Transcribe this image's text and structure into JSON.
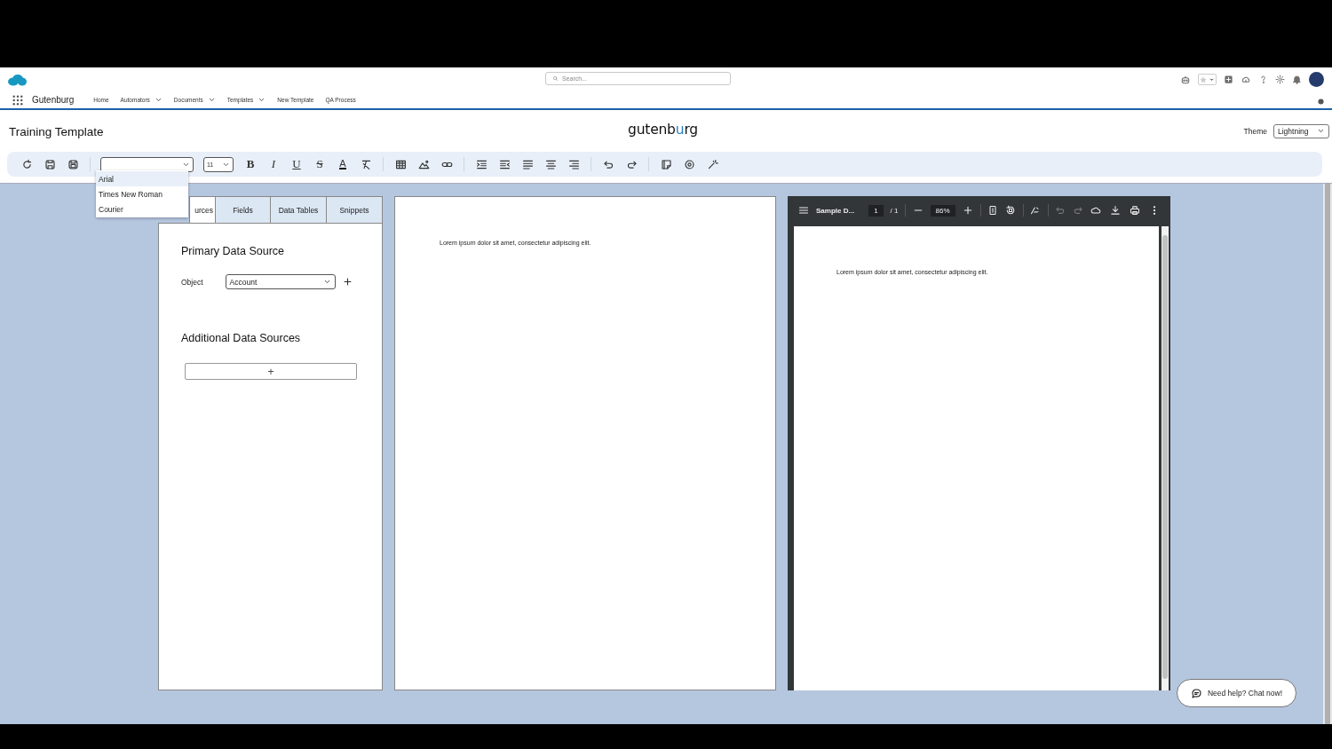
{
  "header": {
    "search": {
      "placeholder": "Search..."
    }
  },
  "nav": {
    "app_name": "Gutenburg",
    "items": [
      {
        "label": "Home",
        "menu": false
      },
      {
        "label": "Automators",
        "menu": true
      },
      {
        "label": "Documents",
        "menu": true
      },
      {
        "label": "Templates",
        "menu": true
      },
      {
        "label": "New Template",
        "menu": false
      },
      {
        "label": "QA Process",
        "menu": false
      }
    ]
  },
  "page": {
    "title": "Training Template",
    "logo": [
      {
        "text": "gutenb",
        "accent": false
      },
      {
        "text": "u",
        "accent": true
      },
      {
        "text": "rg",
        "accent": false
      }
    ],
    "theme": {
      "label": "Theme",
      "value": "Lightning"
    }
  },
  "toolbar": {
    "font_size": "11",
    "format_buttons": [
      "B",
      "I",
      "U",
      "S",
      "A"
    ],
    "font_menu": [
      {
        "label": "Arial",
        "selected": true
      },
      {
        "label": "Times New Roman",
        "selected": false
      },
      {
        "label": "Courier",
        "selected": false
      }
    ]
  },
  "sources_panel": {
    "tabs": [
      {
        "label": "urces",
        "selected": true
      },
      {
        "label": "Fields",
        "selected": false
      },
      {
        "label": "Data Tables",
        "selected": false
      },
      {
        "label": "Snippets",
        "selected": false
      }
    ],
    "primary_heading": "Primary Data Source",
    "object_label": "Object",
    "object_value": "Account",
    "additional_heading": "Additional Data Sources",
    "add_button": "+"
  },
  "editor": {
    "text": "Lorem ipsum dolor sit amet, consectetur adipiscing elit."
  },
  "pdf_viewer": {
    "file_name": "Sample D...",
    "page": "1",
    "page_total": "/ 1",
    "zoom": "86%",
    "text": "Lorem ipsum dolor sit amet, consectetur adipiscing elit."
  },
  "chat_button": "Need help? Chat now!"
}
